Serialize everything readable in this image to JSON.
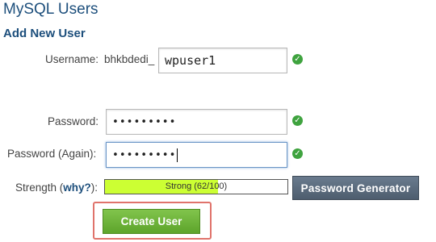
{
  "page": {
    "title": "MySQL Users",
    "section_title": "Add New User"
  },
  "form": {
    "username": {
      "label": "Username:",
      "prefix": "bhkbdedi_",
      "value": "wpuser1"
    },
    "password": {
      "label": "Password:",
      "masked_value": "•••••••••"
    },
    "password_again": {
      "label": "Password (Again):",
      "masked_value": "•••••••••"
    },
    "strength": {
      "label_prefix": "Strength (",
      "why_link": "why?",
      "label_suffix": "):",
      "meter_text": "Strong (62/100)",
      "score": 62,
      "max": 100,
      "fill_color": "#ccff33"
    },
    "valid_icon": "check-circle-icon",
    "valid_color": "#3fa33f"
  },
  "buttons": {
    "password_generator": "Password Generator",
    "create_user": "Create User"
  },
  "colors": {
    "heading": "#1d4f7c",
    "create_button": "#6fb63a",
    "highlight_border": "#e0736b"
  }
}
